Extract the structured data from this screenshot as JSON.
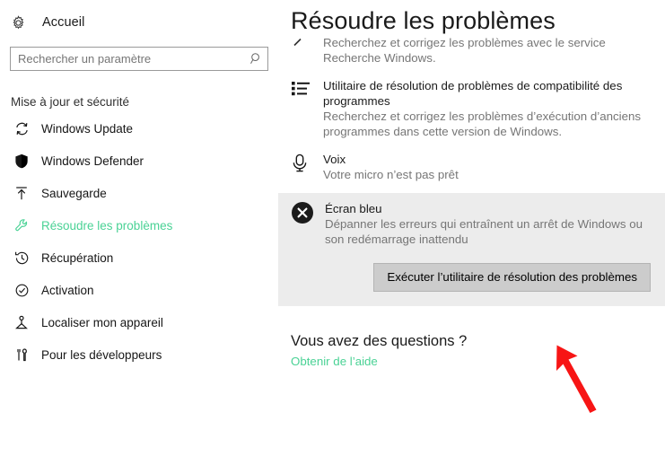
{
  "sidebar": {
    "home": {
      "label": "Accueil",
      "icon": "gear-icon"
    },
    "search": {
      "value": "",
      "placeholder": "Rechercher un paramètre",
      "icon": "search-icon"
    },
    "section_title": "Mise à jour et sécurité",
    "items": [
      {
        "label": "Windows Update",
        "icon": "refresh-icon",
        "selected": false
      },
      {
        "label": "Windows Defender",
        "icon": "shield-icon",
        "selected": false
      },
      {
        "label": "Sauvegarde",
        "icon": "upload-arrow-icon",
        "selected": false
      },
      {
        "label": "Résoudre les problèmes",
        "icon": "wrench-icon",
        "selected": true
      },
      {
        "label": "Récupération",
        "icon": "history-clock-icon",
        "selected": false
      },
      {
        "label": "Activation",
        "icon": "check-circle-icon",
        "selected": false
      },
      {
        "label": "Localiser mon appareil",
        "icon": "locate-device-icon",
        "selected": false
      },
      {
        "label": "Pour les développeurs",
        "icon": "tools-icon",
        "selected": false
      }
    ]
  },
  "main": {
    "title": "Résoudre les problèmes",
    "troubleshooters": [
      {
        "name": "",
        "desc": "Recherchez et corrigez les problèmes avec le service Recherche Windows.",
        "icon": "search-partial-icon"
      },
      {
        "name": "Utilitaire de résolution de problèmes de compatibilité des programmes",
        "desc": "Recherchez et corrigez les problèmes d’exécution d’anciens programmes dans cette version de Windows.",
        "icon": "list-icon"
      },
      {
        "name": "Voix",
        "desc": "Votre micro n’est pas prêt",
        "icon": "microphone-icon"
      }
    ],
    "highlighted": {
      "name": "Écran bleu",
      "desc": "Dépanner les erreurs qui entraînent un arrêt de Windows ou son redémarrage inattendu",
      "icon": "error-x-circle-icon",
      "run_button": "Exécuter l’utilitaire de résolution des problèmes"
    },
    "questions": {
      "heading": "Vous avez des questions ?",
      "link": "Obtenir de l’aide"
    }
  },
  "annotation": {
    "arrow_color": "#f71515",
    "type": "red-arrow-pointing-to-run-button"
  },
  "colors": {
    "accent_green": "#4ad295",
    "highlight_bg": "#ececec",
    "button_bg": "#cccccc",
    "muted_text": "#767676"
  }
}
